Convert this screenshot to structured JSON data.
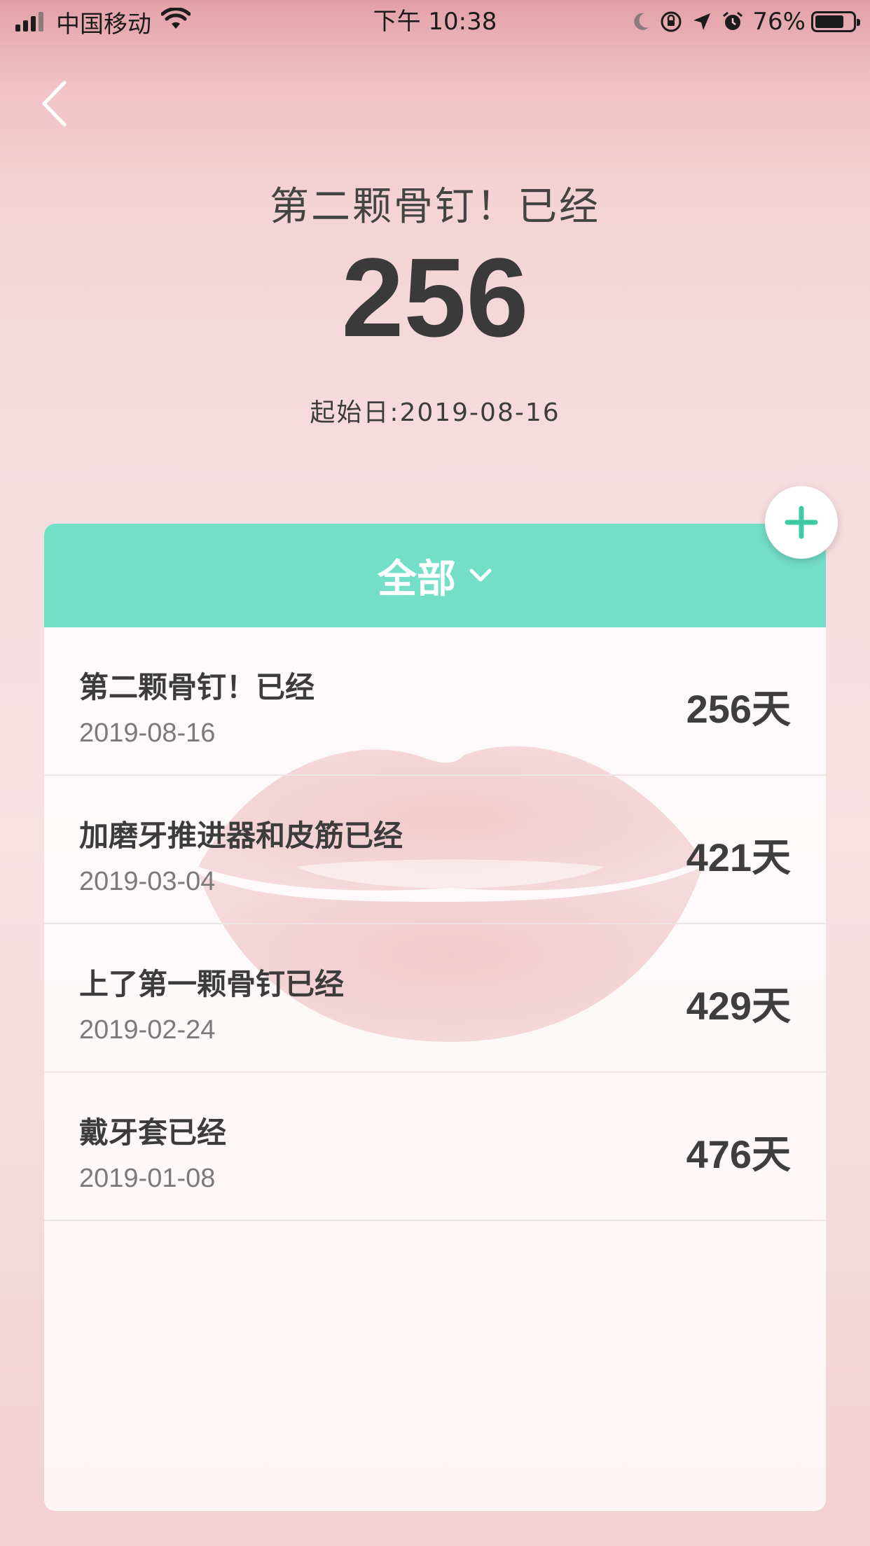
{
  "status_bar": {
    "carrier": "中国移动",
    "time": "下午 10:38",
    "battery_percent": "76%",
    "battery_level": 0.76,
    "icons": [
      "signal-icon",
      "wifi-icon",
      "moon-icon",
      "rotation-lock-icon",
      "location-icon",
      "alarm-icon",
      "battery-icon"
    ]
  },
  "nav": {
    "back_icon": "chevron-left-icon"
  },
  "hero": {
    "title": "第二颗骨钉！已经",
    "count": "256",
    "start_date": "起始日:2019-08-16"
  },
  "list": {
    "filter_label": "全部",
    "filter_icon": "chevron-down-icon",
    "add_icon": "plus-icon",
    "items": [
      {
        "title": "第二颗骨钉！已经",
        "date": "2019-08-16",
        "days": "256天"
      },
      {
        "title": "加磨牙推进器和皮筋已经",
        "date": "2019-03-04",
        "days": "421天"
      },
      {
        "title": "上了第一颗骨钉已经",
        "date": "2019-02-24",
        "days": "429天"
      },
      {
        "title": "戴牙套已经",
        "date": "2019-01-08",
        "days": "476天"
      }
    ]
  },
  "colors": {
    "accent": "#74dfc7",
    "add_icon": "#3fc9a3",
    "background_top": "#e2a0a6",
    "background": "#f6dde0",
    "text_dark": "#3b3b3b",
    "text_muted": "#7a7a7a"
  }
}
